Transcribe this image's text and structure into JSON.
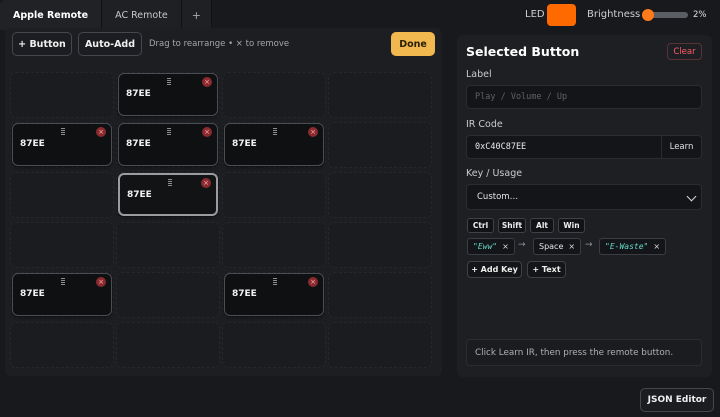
{
  "tabs": [
    {
      "label": "Apple Remote",
      "active": true
    },
    {
      "label": "AC Remote",
      "active": false
    },
    {
      "label": "+",
      "active": false
    }
  ],
  "header": {
    "led_label": "LED",
    "led_color": "#ff6a00",
    "brightness_label": "Brightness",
    "brightness_value": "2%",
    "brightness_fraction": 0.02
  },
  "toolbar": {
    "add_button_label": "+ Button",
    "auto_add_label": "Auto-Add",
    "hint": "Drag to rearrange • × to remove",
    "done_label": "Done"
  },
  "remote_buttons": [
    {
      "code": "87EE",
      "row": 0,
      "col": 1
    },
    {
      "code": "87EE",
      "row": 1,
      "col": 0
    },
    {
      "code": "87EE",
      "row": 1,
      "col": 1
    },
    {
      "code": "87EE",
      "row": 1,
      "col": 2
    },
    {
      "code": "87EE",
      "row": 2,
      "col": 1,
      "selected": true
    },
    {
      "code": "87EE",
      "row": 4,
      "col": 0
    },
    {
      "code": "87EE",
      "row": 4,
      "col": 2
    }
  ],
  "selected_panel": {
    "title": "Selected Button",
    "clear_label": "Clear",
    "label_field": {
      "label": "Label",
      "placeholder": "Play / Volume / Up"
    },
    "ir_field": {
      "label": "IR Code",
      "value": "0xC40C87EE",
      "learn_label": "Learn"
    },
    "key_field": {
      "label": "Key / Usage",
      "selected": "Custom…"
    },
    "modifiers": [
      "Ctrl",
      "Shift",
      "Alt",
      "Win"
    ],
    "sequence": [
      {
        "text": "\"Eww\"",
        "quoted": true
      },
      {
        "text": "Space",
        "quoted": false
      },
      {
        "text": "\"E-Waste\"",
        "quoted": true
      }
    ],
    "remove_glyph": "×",
    "sequence_arrow": "→",
    "add_key_label": "+ Add Key",
    "add_text_label": "+ Text",
    "status": "Click Learn IR, then press the remote button."
  },
  "footer": {
    "json_editor_label": "JSON Editor"
  }
}
